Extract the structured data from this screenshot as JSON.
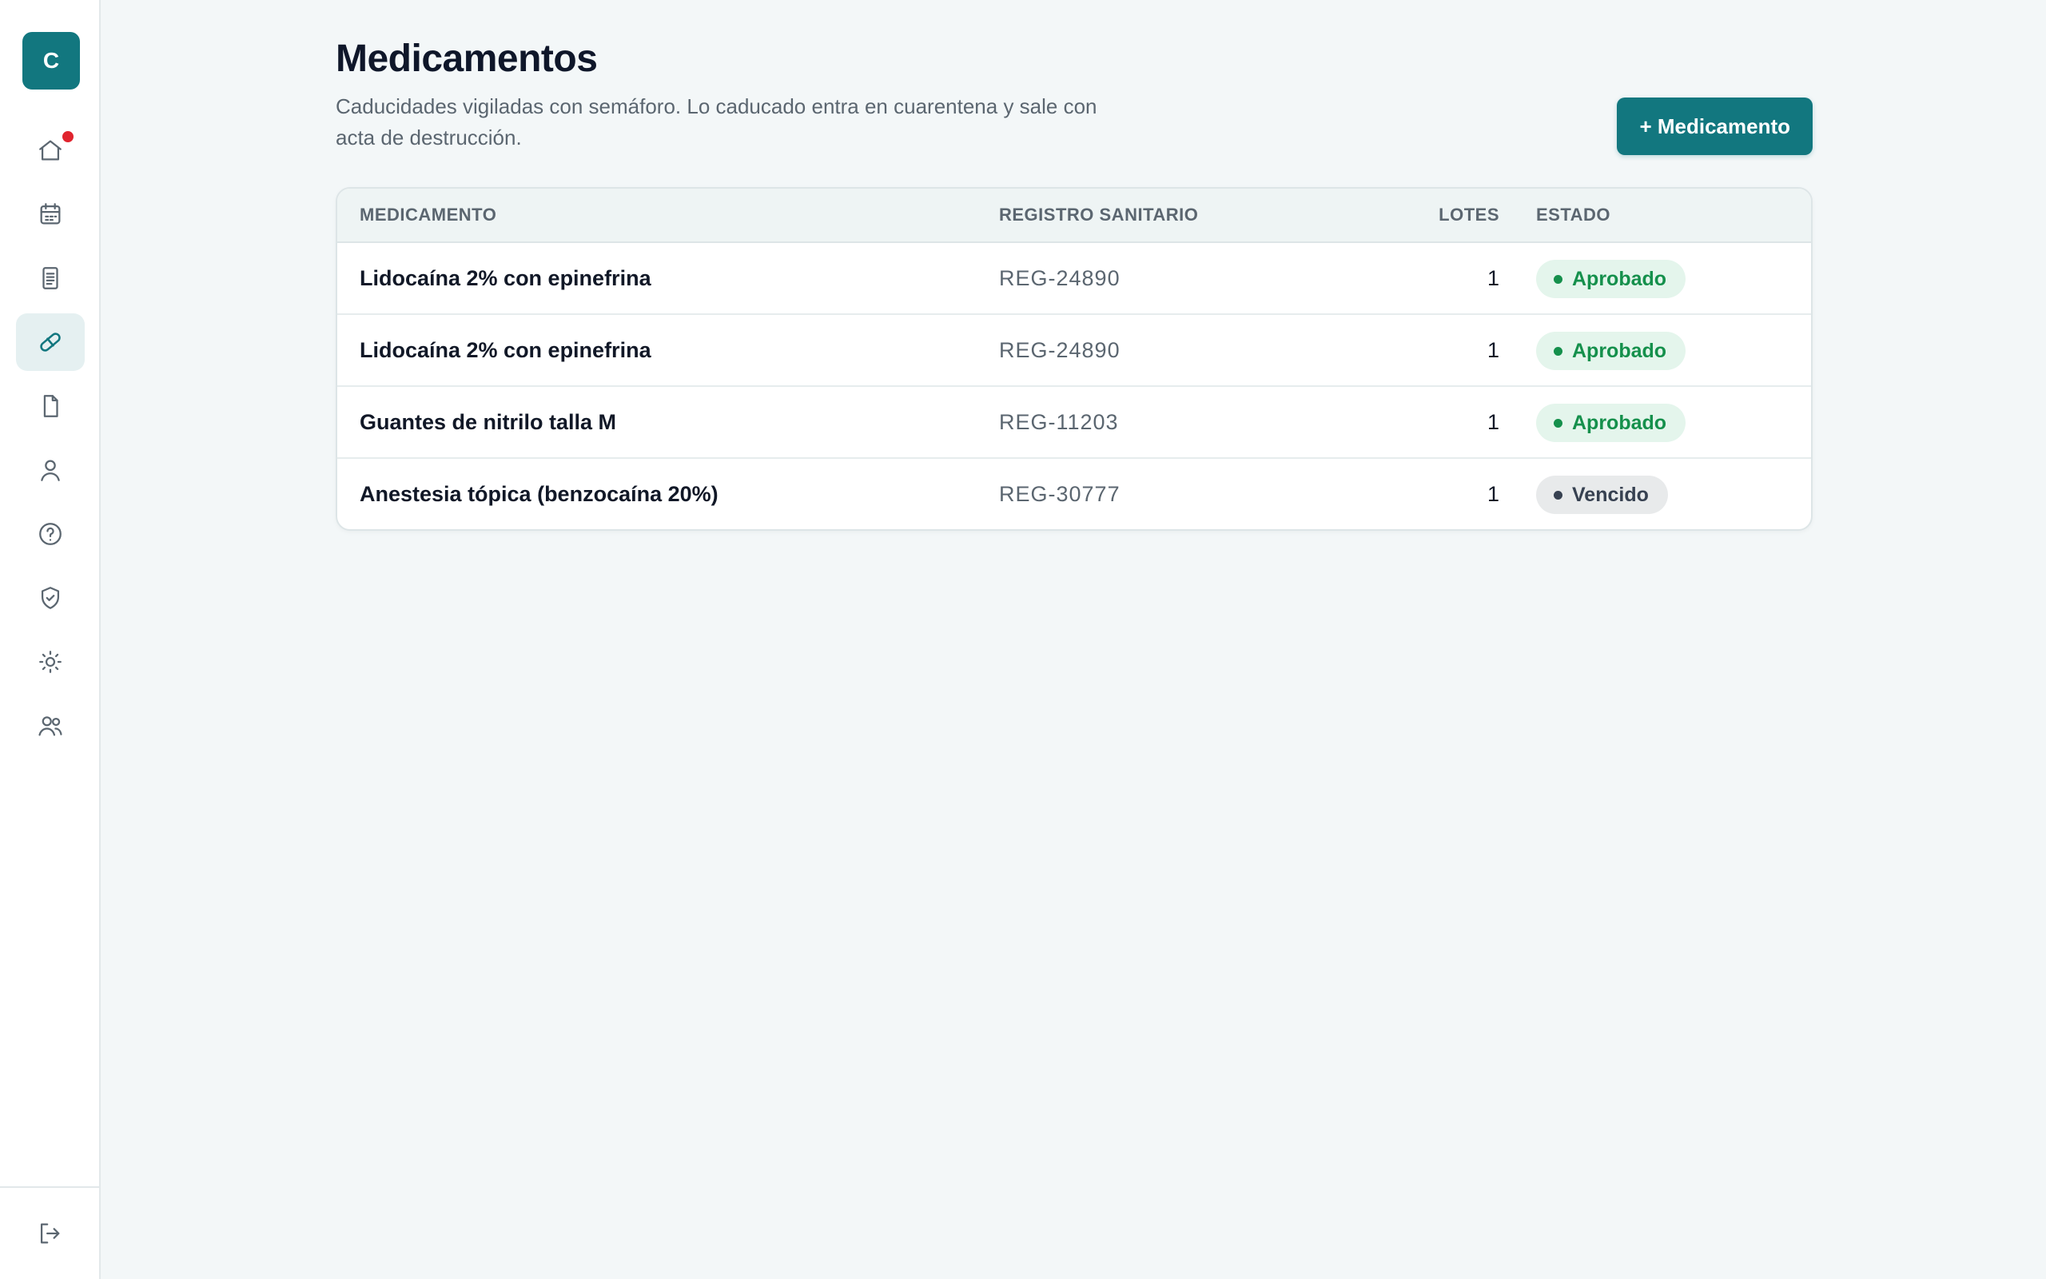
{
  "sidebar": {
    "logo": "C",
    "items": [
      {
        "name": "home",
        "icon": "home-icon",
        "badge": true
      },
      {
        "name": "calendar",
        "icon": "calendar-icon"
      },
      {
        "name": "receipt",
        "icon": "receipt-icon"
      },
      {
        "name": "medications",
        "icon": "pill-icon",
        "active": true
      },
      {
        "name": "document",
        "icon": "file-icon"
      },
      {
        "name": "profile",
        "icon": "user-icon"
      },
      {
        "name": "help",
        "icon": "help-circle-icon"
      },
      {
        "name": "security",
        "icon": "shield-check-icon"
      },
      {
        "name": "settings",
        "icon": "sun-icon"
      },
      {
        "name": "team",
        "icon": "users-icon"
      }
    ],
    "logout_icon": "logout-icon"
  },
  "header": {
    "title": "Medicamentos",
    "subtitle": "Caducidades vigiladas con semáforo. Lo caducado entra en cuarentena y sale con acta de destrucción.",
    "add_button": "+ Medicamento"
  },
  "table": {
    "columns": {
      "name": "MEDICAMENTO",
      "registry": "REGISTRO SANITARIO",
      "lots": "LOTES",
      "status": "ESTADO"
    },
    "rows": [
      {
        "name": "Lidocaína 2% con epinefrina",
        "registry": "REG-24890",
        "lots": "1",
        "status": "Aprobado"
      },
      {
        "name": "Lidocaína 2% con epinefrina",
        "registry": "REG-24890",
        "lots": "1",
        "status": "Aprobado"
      },
      {
        "name": "Guantes de nitrilo talla M",
        "registry": "REG-11203",
        "lots": "1",
        "status": "Aprobado"
      },
      {
        "name": "Anestesia tópica (benzocaína 20%)",
        "registry": "REG-30777",
        "lots": "1",
        "status": "Vencido"
      }
    ]
  },
  "colors": {
    "accent": "#12777f",
    "approved": "#15904c",
    "expired": "#374151",
    "notification": "#e0242e"
  }
}
